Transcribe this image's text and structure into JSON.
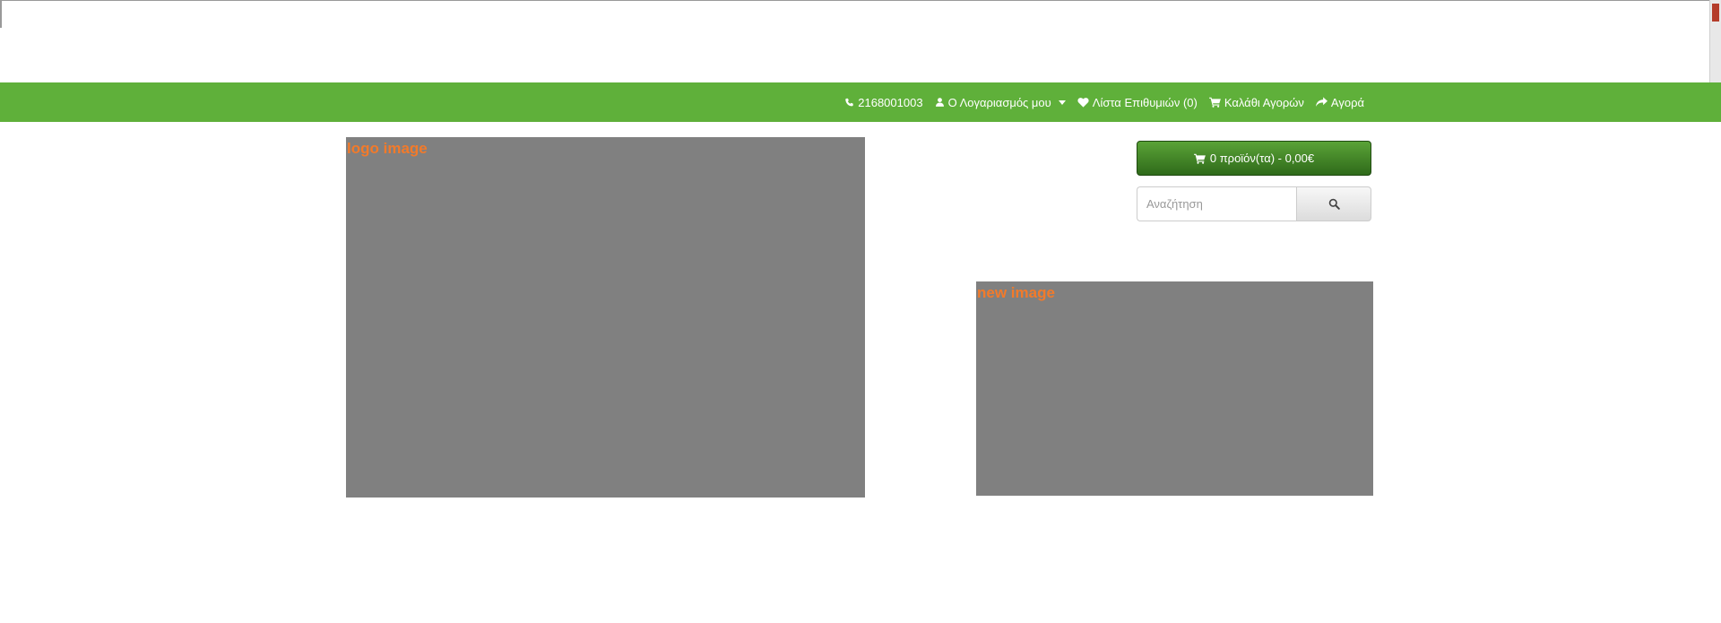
{
  "topbar": {
    "phone": "2168001003",
    "account_label": "Ο Λογαριασμός μου",
    "wishlist_label": "Λίστα Επιθυμιών (0)",
    "cart_label": "Καλάθι Αγορών",
    "checkout_label": "Αγορά"
  },
  "header": {
    "logo_alt_text": "logo image",
    "cart_button_label": "0 προϊόν(τα) - 0,00€",
    "search_placeholder": "Αναζήτηση"
  },
  "banner": {
    "alt_text": "new image"
  },
  "colors": {
    "navbar_green": "#5fb03a",
    "cart_button_green": "#3d7f24",
    "image_placeholder_gray": "#808080",
    "alt_text_orange": "#f27a2a"
  },
  "icons": [
    "phone-icon",
    "user-icon",
    "caret-down-icon",
    "heart-icon",
    "shopping-cart-icon",
    "share-icon",
    "search-icon"
  ]
}
